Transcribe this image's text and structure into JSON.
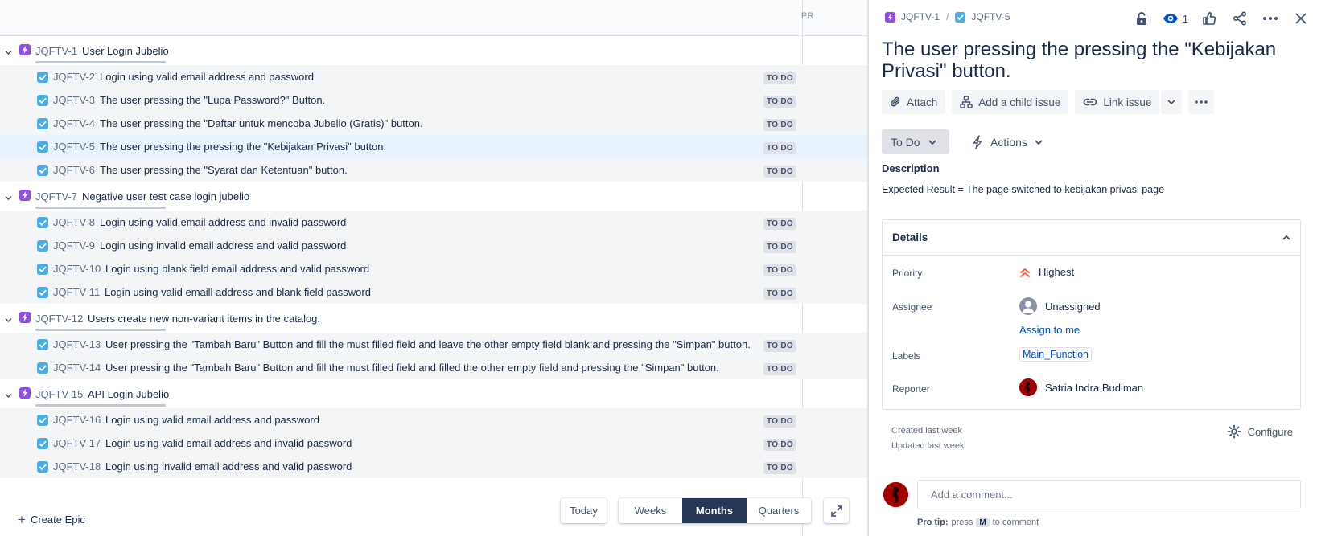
{
  "timeline": {
    "column_label": "PR",
    "epics": [
      {
        "key": "JQFTV-1",
        "summary": "User Login Jubelio",
        "tasks": [
          {
            "key": "JQFTV-2",
            "summary": "Login using valid email address and password",
            "status": "TO DO"
          },
          {
            "key": "JQFTV-3",
            "summary": "The user pressing the \"Lupa Password?\" Button.",
            "status": "TO DO"
          },
          {
            "key": "JQFTV-4",
            "summary": "The user pressing the \"Daftar untuk mencoba Jubelio (Gratis)\" button.",
            "status": "TO DO"
          },
          {
            "key": "JQFTV-5",
            "summary": "The user pressing the pressing the \"Kebijakan Privasi\" button.",
            "status": "TO DO",
            "selected": true
          },
          {
            "key": "JQFTV-6",
            "summary": "The user pressing the \"Syarat dan Ketentuan\" button.",
            "status": "TO DO"
          }
        ]
      },
      {
        "key": "JQFTV-7",
        "summary": "Negative user test case login jubelio",
        "tasks": [
          {
            "key": "JQFTV-8",
            "summary": "Login using valid email address and invalid password",
            "status": "TO DO"
          },
          {
            "key": "JQFTV-9",
            "summary": "Login using invalid email address and valid password",
            "status": "TO DO"
          },
          {
            "key": "JQFTV-10",
            "summary": "Login using blank field email address and valid password",
            "status": "TO DO"
          },
          {
            "key": "JQFTV-11",
            "summary": "Login using valid emaill address and blank field password",
            "status": "TO DO"
          }
        ]
      },
      {
        "key": "JQFTV-12",
        "summary": "Users create new non-variant items in the catalog.",
        "tasks": [
          {
            "key": "JQFTV-13",
            "summary": "User pressing the \"Tambah Baru\" Button and fill the must filled field and leave the other empty field blank and pressing the \"Simpan\" button.",
            "status": "TO DO"
          },
          {
            "key": "JQFTV-14",
            "summary": "User pressing the \"Tambah Baru\" Button and fill the must filled field and filled the other empty field and pressing the \"Simpan\" button.",
            "status": "TO DO"
          }
        ]
      },
      {
        "key": "JQFTV-15",
        "summary": "API Login Jubelio",
        "tasks": [
          {
            "key": "JQFTV-16",
            "summary": "Login using valid email address and password",
            "status": "TO DO"
          },
          {
            "key": "JQFTV-17",
            "summary": "Login using valid email address and invalid password",
            "status": "TO DO"
          },
          {
            "key": "JQFTV-18",
            "summary": "Login using invalid email address and valid password",
            "status": "TO DO"
          }
        ]
      }
    ],
    "create_epic_label": "Create Epic",
    "today_label": "Today",
    "scales": [
      "Weeks",
      "Months",
      "Quarters"
    ],
    "active_scale": "Months"
  },
  "issue": {
    "breadcrumb_epic": "JQFTV-1",
    "breadcrumb_sep": "/",
    "breadcrumb_issue": "JQFTV-5",
    "watchers": "1",
    "title": "The user pressing the pressing the \"Kebijakan Privasi\" button.",
    "buttons": {
      "attach": "Attach",
      "child": "Add a child issue",
      "link": "Link issue"
    },
    "status": "To Do",
    "actions": "Actions",
    "description_label": "Description",
    "description": "Expected Result = The page switched to kebijakan privasi page",
    "details": {
      "title": "Details",
      "priority_label": "Priority",
      "priority": "Highest",
      "assignee_label": "Assignee",
      "assignee": "Unassigned",
      "assign_to_me": "Assign to me",
      "labels_label": "Labels",
      "label_value": "Main_Function",
      "reporter_label": "Reporter",
      "reporter": "Satria Indra Budiman"
    },
    "created": "Created last week",
    "updated": "Updated last week",
    "configure": "Configure",
    "comment_placeholder": "Add a comment...",
    "protip_prefix": "Pro tip:",
    "protip_press": "press",
    "protip_key": "M",
    "protip_suffix": "to comment"
  },
  "colors": {
    "epic": "#904ee2",
    "task": "#4bade8",
    "selected_row": "#e9f2ff",
    "group_band": "#f4f5f7",
    "active_scale": "#253858",
    "priority_highest": "#ff5630"
  }
}
